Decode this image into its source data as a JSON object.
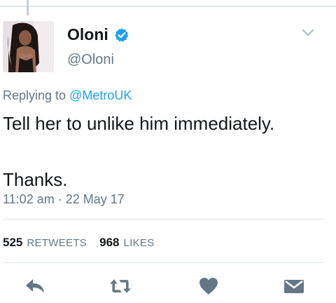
{
  "tweet": {
    "display_name": "Oloni",
    "handle": "@Oloni",
    "verified": true,
    "reply_prefix": "Replying to",
    "reply_to": "@MetroUK",
    "text_line1": "Tell her to unlike him immediately.",
    "text_line2": "Thanks.",
    "timestamp": "11:02 am · 22 May 17"
  },
  "stats": {
    "retweets_count": "525",
    "retweets_label": "RETWEETS",
    "likes_count": "968",
    "likes_label": "LIKES"
  },
  "actions": [
    "reply-icon",
    "retweet-icon",
    "like-icon",
    "direct-message-icon"
  ],
  "colors": {
    "accent": "#1da1f2",
    "secondary_text": "#657786",
    "icon": "#657786",
    "divider": "#e1e8ed"
  }
}
